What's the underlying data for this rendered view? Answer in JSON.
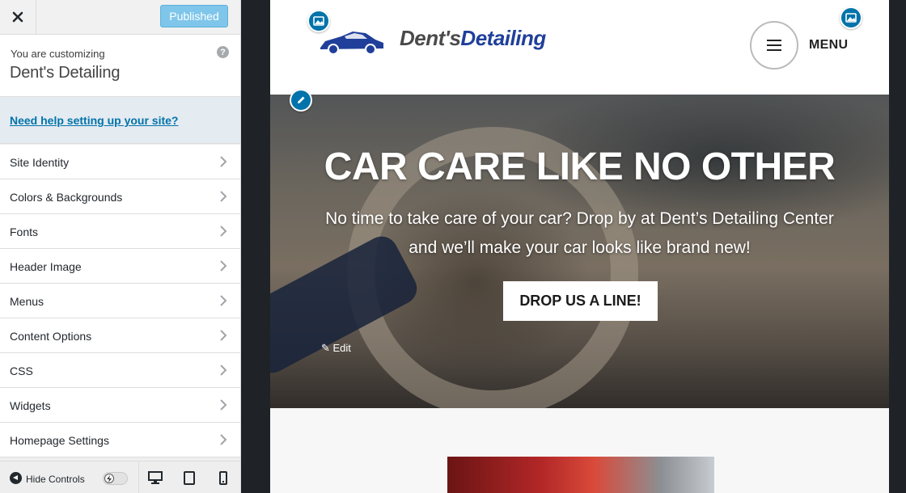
{
  "sidebar": {
    "close_label": "×",
    "publish_label": "Published",
    "customizing_label": "You are customizing",
    "site_name": "Dent's Detailing",
    "help_icon": "?",
    "help_link": "Need help setting up your site?",
    "items": [
      {
        "label": "Site Identity"
      },
      {
        "label": "Colors & Backgrounds"
      },
      {
        "label": "Fonts"
      },
      {
        "label": "Header Image"
      },
      {
        "label": "Menus"
      },
      {
        "label": "Content Options"
      },
      {
        "label": "CSS"
      },
      {
        "label": "Widgets"
      },
      {
        "label": "Homepage Settings"
      }
    ],
    "footer": {
      "hide_controls_label": "Hide Controls",
      "devices": [
        "desktop-icon",
        "tablet-icon",
        "mobile-icon"
      ]
    }
  },
  "preview": {
    "logo_text_part1": "Dent's",
    "logo_text_part2": "Detailing",
    "menu_label": "MENU",
    "hero": {
      "title": "CAR CARE LIKE NO OTHER",
      "subtitle_line1": "No time to take care of your car? Drop by at Dent’s Detailing Center",
      "subtitle_line2": "and we’ll make your car looks like brand new!",
      "cta_label": "DROP US A LINE!",
      "edit_label": "✎ Edit"
    }
  },
  "colors": {
    "accent": "#0073aa",
    "publish_button": "#7fc6ea",
    "logo_blue": "#203f9a"
  }
}
